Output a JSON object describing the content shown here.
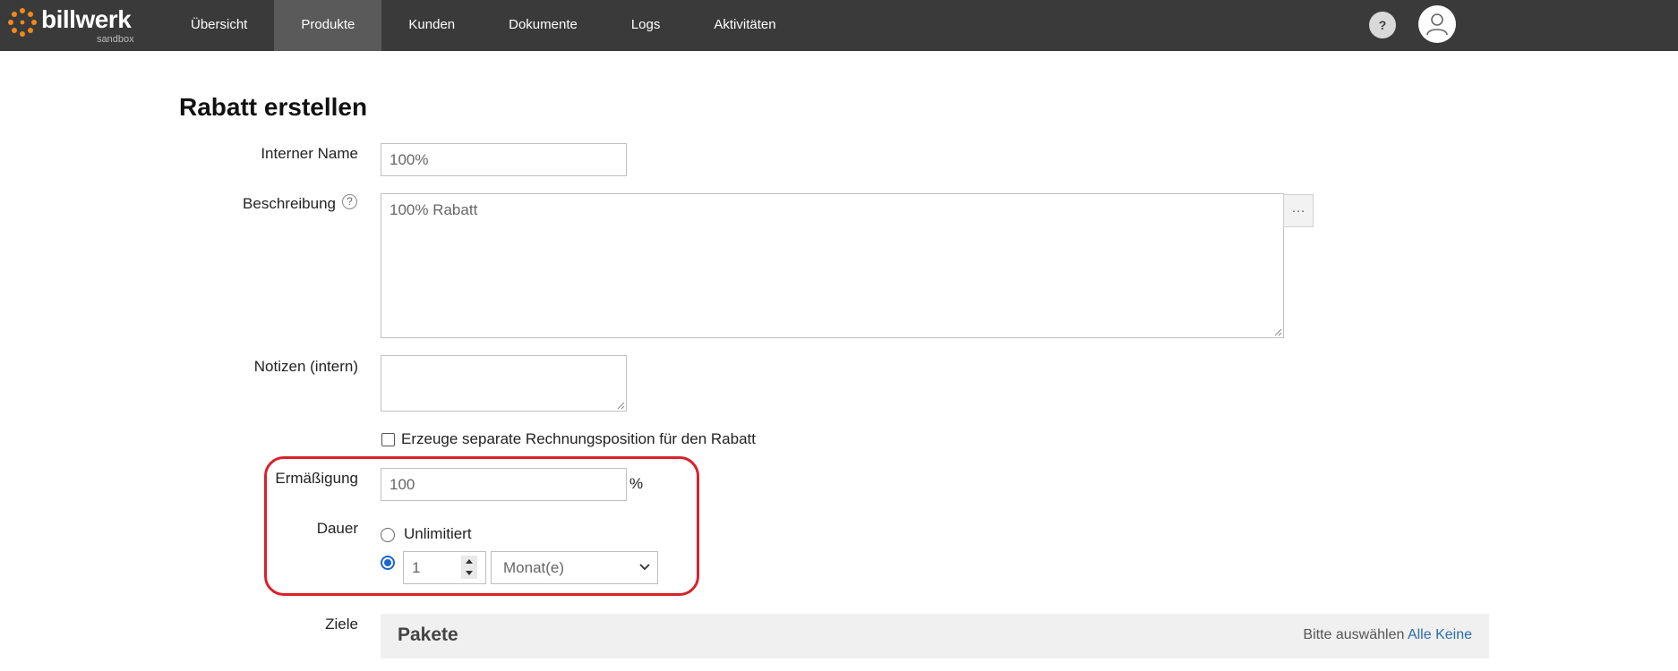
{
  "app": {
    "logo_text": "billwerk",
    "logo_subtitle": "sandbox"
  },
  "nav": {
    "items": [
      {
        "label": "Übersicht"
      },
      {
        "label": "Produkte",
        "active": true
      },
      {
        "label": "Kunden"
      },
      {
        "label": "Dokumente"
      },
      {
        "label": "Logs"
      },
      {
        "label": "Aktivitäten"
      }
    ],
    "help_label": "?"
  },
  "page": {
    "title": "Rabatt erstellen"
  },
  "form": {
    "internal_name": {
      "label": "Interner Name",
      "value": "100%"
    },
    "description": {
      "label": "Beschreibung",
      "value": "100% Rabatt",
      "help_icon": "?",
      "more_button": "…"
    },
    "notes": {
      "label": "Notizen (intern)",
      "value": ""
    },
    "separate_position": {
      "label": "Erzeuge separate Rechnungsposition für den Rabatt",
      "checked": false
    },
    "reduction": {
      "label": "Ermäßigung",
      "value": "100",
      "unit": "%"
    },
    "duration": {
      "label": "Dauer",
      "unlimited_label": "Unlimitiert",
      "unlimited_selected": false,
      "count_value": "1",
      "period_selected": "Monat(e)"
    },
    "targets": {
      "label": "Ziele",
      "section_title": "Pakete",
      "select_prompt": "Bitte auswählen",
      "all_link": "Alle",
      "none_link": "Keine"
    }
  },
  "colors": {
    "topbar": "#3a3a3a",
    "active_nav": "#5a5a5a",
    "highlight": "#d9212c",
    "link": "#2d6ca8",
    "radio_accent": "#1a66d6"
  }
}
